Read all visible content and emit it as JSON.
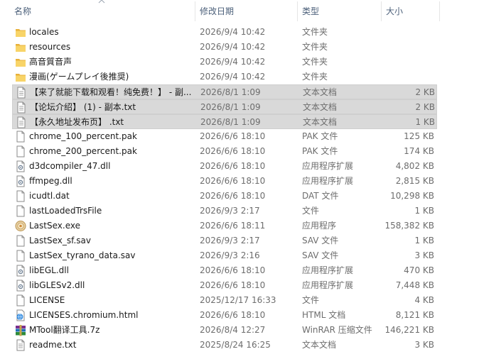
{
  "columns": {
    "name": "名称",
    "date": "修改日期",
    "type": "类型",
    "size": "大小"
  },
  "files": [
    {
      "name": "locales",
      "date": "2026/9/4 10:42",
      "type": "文件夹",
      "size": "",
      "icon": "folder-icon",
      "selected": false
    },
    {
      "name": "resources",
      "date": "2026/9/4 10:42",
      "type": "文件夹",
      "size": "",
      "icon": "folder-icon",
      "selected": false
    },
    {
      "name": "高音質音声",
      "date": "2026/9/4 10:42",
      "type": "文件夹",
      "size": "",
      "icon": "folder-icon",
      "selected": false
    },
    {
      "name": "漫画(ゲームプレイ後推奨)",
      "date": "2026/9/4 10:42",
      "type": "文件夹",
      "size": "",
      "icon": "folder-icon",
      "selected": false
    },
    {
      "name": "【来了就能下载和观看！纯免费！】 - 副...",
      "date": "2026/8/1 1:09",
      "type": "文本文档",
      "size": "2 KB",
      "icon": "text-file-icon",
      "selected": true
    },
    {
      "name": "【论坛介绍】 (1) - 副本.txt",
      "date": "2026/8/1 1:09",
      "type": "文本文档",
      "size": "2 KB",
      "icon": "text-file-icon",
      "selected": true
    },
    {
      "name": "【永久地址发布页】 .txt",
      "date": "2026/8/1 1:09",
      "type": "文本文档",
      "size": "1 KB",
      "icon": "text-file-icon",
      "selected": true
    },
    {
      "name": "chrome_100_percent.pak",
      "date": "2026/6/6 18:10",
      "type": "PAK 文件",
      "size": "125 KB",
      "icon": "file-icon",
      "selected": false
    },
    {
      "name": "chrome_200_percent.pak",
      "date": "2026/6/6 18:10",
      "type": "PAK 文件",
      "size": "174 KB",
      "icon": "file-icon",
      "selected": false
    },
    {
      "name": "d3dcompiler_47.dll",
      "date": "2026/6/6 18:10",
      "type": "应用程序扩展",
      "size": "4,802 KB",
      "icon": "dll-icon",
      "selected": false
    },
    {
      "name": "ffmpeg.dll",
      "date": "2026/6/6 18:10",
      "type": "应用程序扩展",
      "size": "2,815 KB",
      "icon": "dll-icon",
      "selected": false
    },
    {
      "name": "icudtl.dat",
      "date": "2026/6/6 18:10",
      "type": "DAT 文件",
      "size": "10,298 KB",
      "icon": "file-icon",
      "selected": false
    },
    {
      "name": "lastLoadedTrsFile",
      "date": "2026/9/3 2:17",
      "type": "文件",
      "size": "1 KB",
      "icon": "file-icon",
      "selected": false
    },
    {
      "name": "LastSex.exe",
      "date": "2026/6/6 18:11",
      "type": "应用程序",
      "size": "158,382 KB",
      "icon": "app-icon",
      "selected": false
    },
    {
      "name": "LastSex_sf.sav",
      "date": "2026/9/3 2:17",
      "type": "SAV 文件",
      "size": "1 KB",
      "icon": "file-icon",
      "selected": false
    },
    {
      "name": "LastSex_tyrano_data.sav",
      "date": "2026/9/3 2:16",
      "type": "SAV 文件",
      "size": "3 KB",
      "icon": "file-icon",
      "selected": false
    },
    {
      "name": "libEGL.dll",
      "date": "2026/6/6 18:10",
      "type": "应用程序扩展",
      "size": "470 KB",
      "icon": "dll-icon",
      "selected": false
    },
    {
      "name": "libGLESv2.dll",
      "date": "2026/6/6 18:10",
      "type": "应用程序扩展",
      "size": "7,448 KB",
      "icon": "dll-icon",
      "selected": false
    },
    {
      "name": "LICENSE",
      "date": "2025/12/17 16:33",
      "type": "文件",
      "size": "4 KB",
      "icon": "file-icon",
      "selected": false
    },
    {
      "name": "LICENSES.chromium.html",
      "date": "2026/6/6 18:10",
      "type": "HTML 文档",
      "size": "8,121 KB",
      "icon": "html-icon",
      "selected": false
    },
    {
      "name": "MTool翻译工具.7z",
      "date": "2026/8/4 12:27",
      "type": "WinRAR 压缩文件",
      "size": "146,221 KB",
      "icon": "archive-icon",
      "selected": false
    },
    {
      "name": "readme.txt",
      "date": "2025/8/24 16:25",
      "type": "文本文档",
      "size": "3 KB",
      "icon": "text-file-icon",
      "selected": false
    }
  ]
}
